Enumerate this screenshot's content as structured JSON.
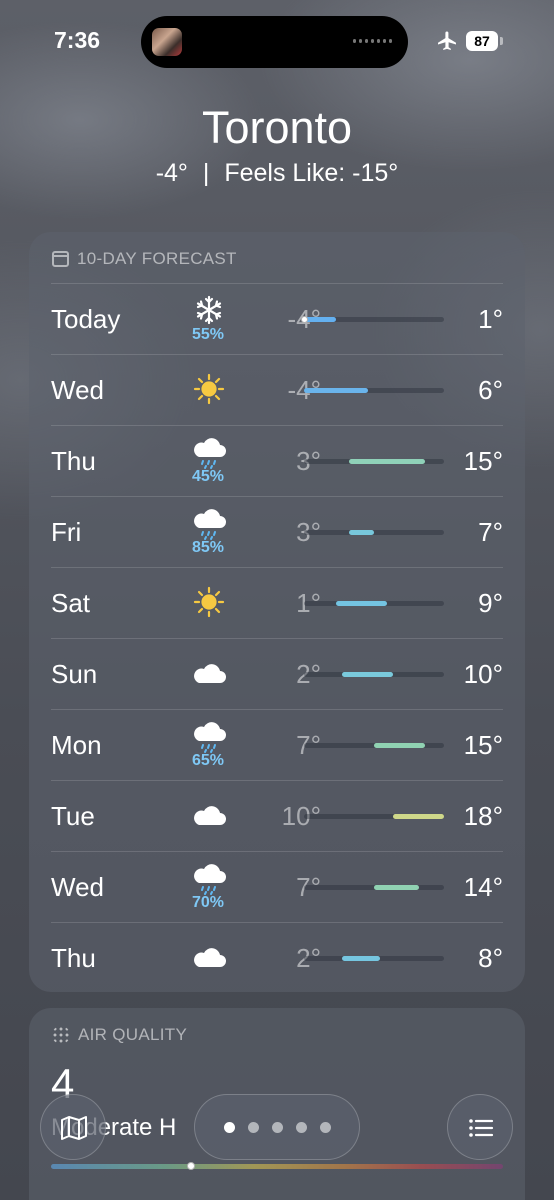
{
  "status_bar": {
    "time": "7:36",
    "battery": "87"
  },
  "header": {
    "city": "Toronto",
    "current_temp": "-4°",
    "separator": "|",
    "feels_like": "Feels Like: -15°"
  },
  "forecast": {
    "title": "10-DAY FORECAST",
    "range_min": -4,
    "range_max": 18,
    "days": [
      {
        "day": "Today",
        "icon": "snowflake-icon",
        "precip": "55%",
        "low": "-4°",
        "high": "1°",
        "low_val": -4,
        "high_val": 1,
        "current_val": -4,
        "color": "#64b0f0"
      },
      {
        "day": "Wed",
        "icon": "sun-icon",
        "precip": "",
        "low": "-4°",
        "high": "6°",
        "low_val": -4,
        "high_val": 6,
        "color": "#6ab4ec"
      },
      {
        "day": "Thu",
        "icon": "cloud-rain-icon",
        "precip": "45%",
        "low": "3°",
        "high": "15°",
        "low_val": 3,
        "high_val": 15,
        "color": "#8fd1b8"
      },
      {
        "day": "Fri",
        "icon": "cloud-rain-icon",
        "precip": "85%",
        "low": "3°",
        "high": "7°",
        "low_val": 3,
        "high_val": 7,
        "color": "#78c8dc"
      },
      {
        "day": "Sat",
        "icon": "sun-icon",
        "precip": "",
        "low": "1°",
        "high": "9°",
        "low_val": 1,
        "high_val": 9,
        "color": "#74c4e2"
      },
      {
        "day": "Sun",
        "icon": "cloud-icon",
        "precip": "",
        "low": "2°",
        "high": "10°",
        "low_val": 2,
        "high_val": 10,
        "color": "#7acadc"
      },
      {
        "day": "Mon",
        "icon": "cloud-rain-icon",
        "precip": "65%",
        "low": "7°",
        "high": "15°",
        "low_val": 7,
        "high_val": 15,
        "color": "#90d2b2"
      },
      {
        "day": "Tue",
        "icon": "cloud-icon",
        "precip": "",
        "low": "10°",
        "high": "18°",
        "low_val": 10,
        "high_val": 18,
        "color": "#cfd88a"
      },
      {
        "day": "Wed",
        "icon": "cloud-rain-icon",
        "precip": "70%",
        "low": "7°",
        "high": "14°",
        "low_val": 7,
        "high_val": 14,
        "color": "#90d2b2"
      },
      {
        "day": "Thu",
        "icon": "cloud-icon",
        "precip": "",
        "low": "2°",
        "high": "8°",
        "low_val": 2,
        "high_val": 8,
        "color": "#76c6e0"
      }
    ]
  },
  "air_quality": {
    "title": "AIR QUALITY",
    "value": "4",
    "label": "Moderate H",
    "level_fraction": 0.31
  },
  "pager": {
    "count": 5,
    "active": 0
  }
}
